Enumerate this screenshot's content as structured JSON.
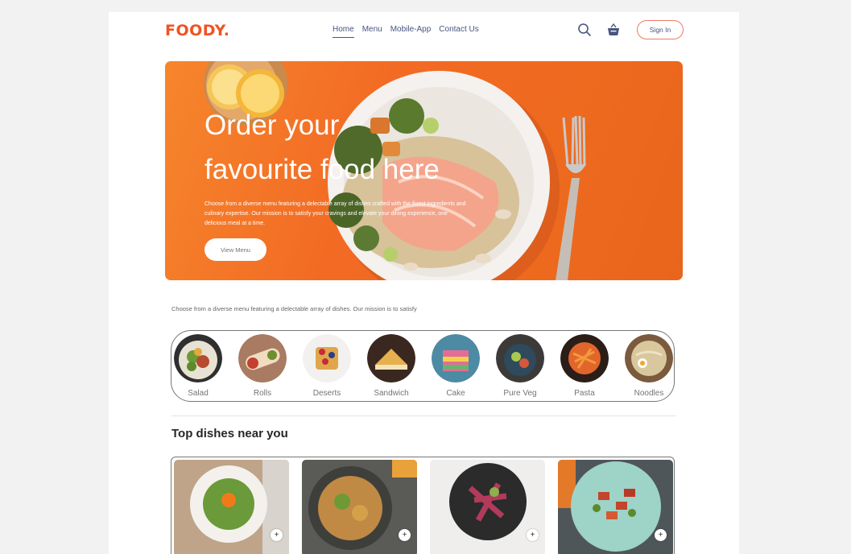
{
  "header": {
    "logo": "FOODY.",
    "nav": [
      "Home",
      "Menu",
      "Mobile-App",
      "Contact Us"
    ],
    "signin_label": "Sign In",
    "icons": [
      "search-icon",
      "basket-icon"
    ]
  },
  "hero": {
    "title_line1": "Order your",
    "title_line2": "favourite food here",
    "description": "Choose from a diverse menu featuring a delectable array of dishes crafted with the finest ingredients and culinary expertise. Our mission is to satisfy your cravings and elevate your dining experience, one delicious meal at a time.",
    "button_label": "View Menu"
  },
  "explore": {
    "text": "Choose from a diverse menu featuring a delectable array of dishes. Our mission is to satisfy",
    "categories": [
      "Salad",
      "Rolls",
      "Deserts",
      "Sandwich",
      "Cake",
      "Pure Veg",
      "Pasta",
      "Noodles"
    ]
  },
  "top_dishes": {
    "title": "Top dishes near you",
    "add_label": "+"
  },
  "colors": {
    "brand": "#f05323",
    "hero_orange": "#f26a24",
    "nav_text": "#49557e"
  }
}
